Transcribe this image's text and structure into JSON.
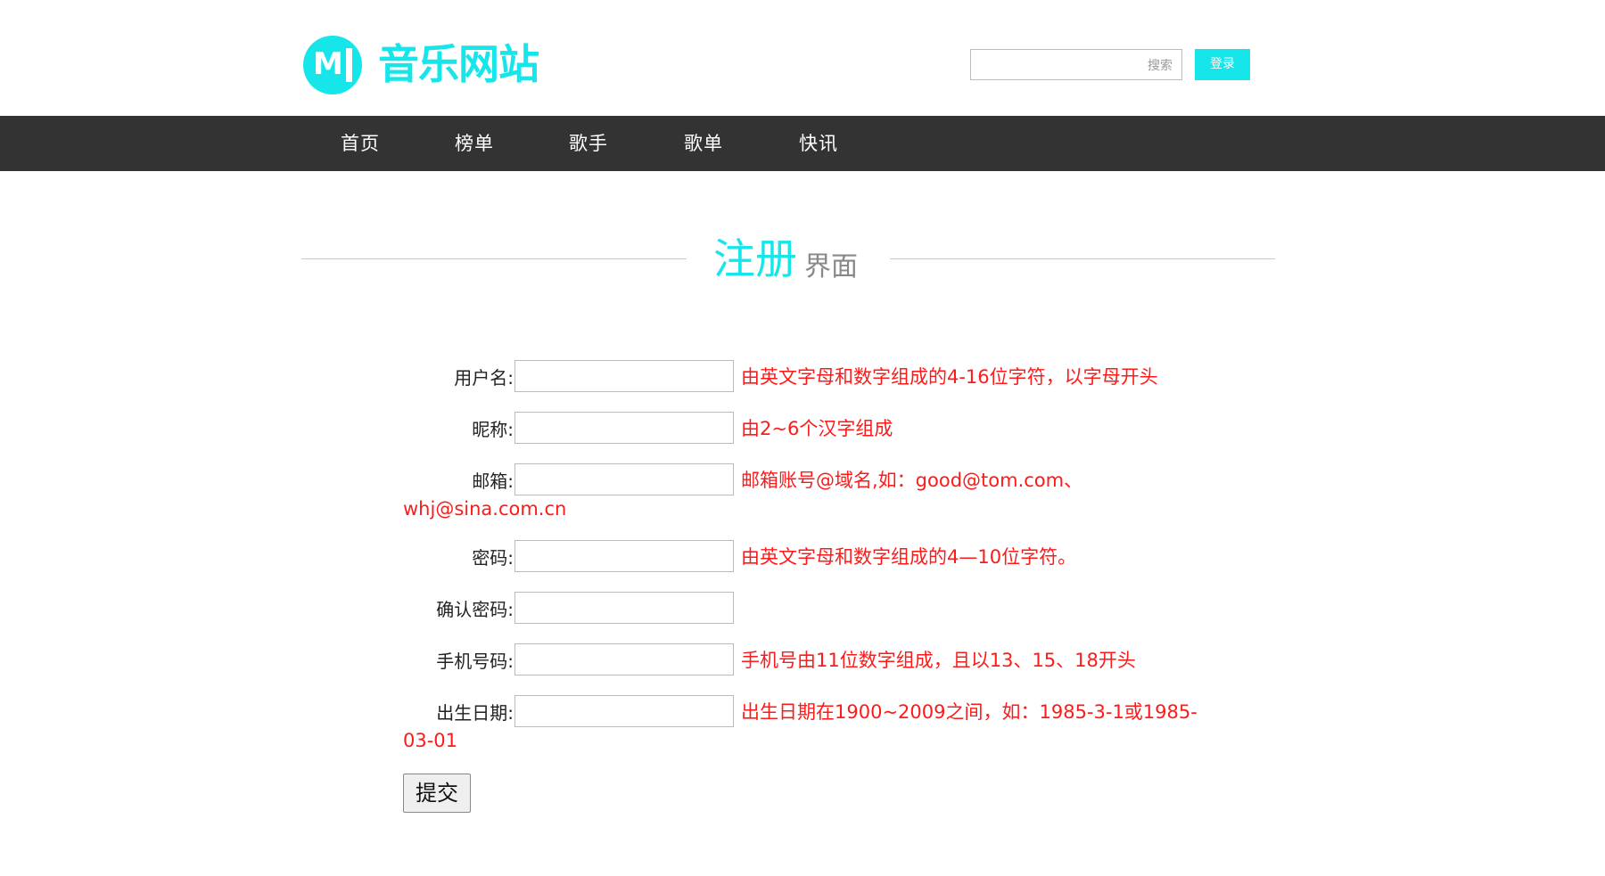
{
  "header": {
    "logo_letter": "M",
    "site_name": "音乐网站",
    "search": {
      "placeholder": "搜索",
      "value": ""
    },
    "login_label": "登录"
  },
  "nav": {
    "items": [
      {
        "label": "首页"
      },
      {
        "label": "榜单"
      },
      {
        "label": "歌手"
      },
      {
        "label": "歌单"
      },
      {
        "label": "快讯"
      }
    ]
  },
  "page_title": {
    "main": "注册",
    "sub": "界面"
  },
  "form": {
    "fields": [
      {
        "label": "用户名:",
        "value": "",
        "hint": "由英文字母和数字组成的4-16位字符，以字母开头",
        "hint_cont": ""
      },
      {
        "label": "昵称:",
        "value": "",
        "hint": "由2~6个汉字组成",
        "hint_cont": ""
      },
      {
        "label": "邮箱:",
        "value": "",
        "hint": "邮箱账号@域名,如：good@tom.com、",
        "hint_cont": "whj@sina.com.cn"
      },
      {
        "label": "密码:",
        "value": "",
        "hint": "由英文字母和数字组成的4—10位字符。",
        "hint_cont": ""
      },
      {
        "label": "确认密码:",
        "value": "",
        "hint": "",
        "hint_cont": ""
      },
      {
        "label": "手机号码:",
        "value": "",
        "hint": "手机号由11位数字组成，且以13、15、18开头",
        "hint_cont": ""
      },
      {
        "label": "出生日期:",
        "value": "",
        "hint": "出生日期在1900~2009之间，如：1985-3-1或1985-",
        "hint_cont": "03-01"
      }
    ],
    "submit_label": "提交"
  },
  "colors": {
    "accent": "#16e6ea",
    "nav_bg": "#333333",
    "hint": "#ff1a1a"
  }
}
